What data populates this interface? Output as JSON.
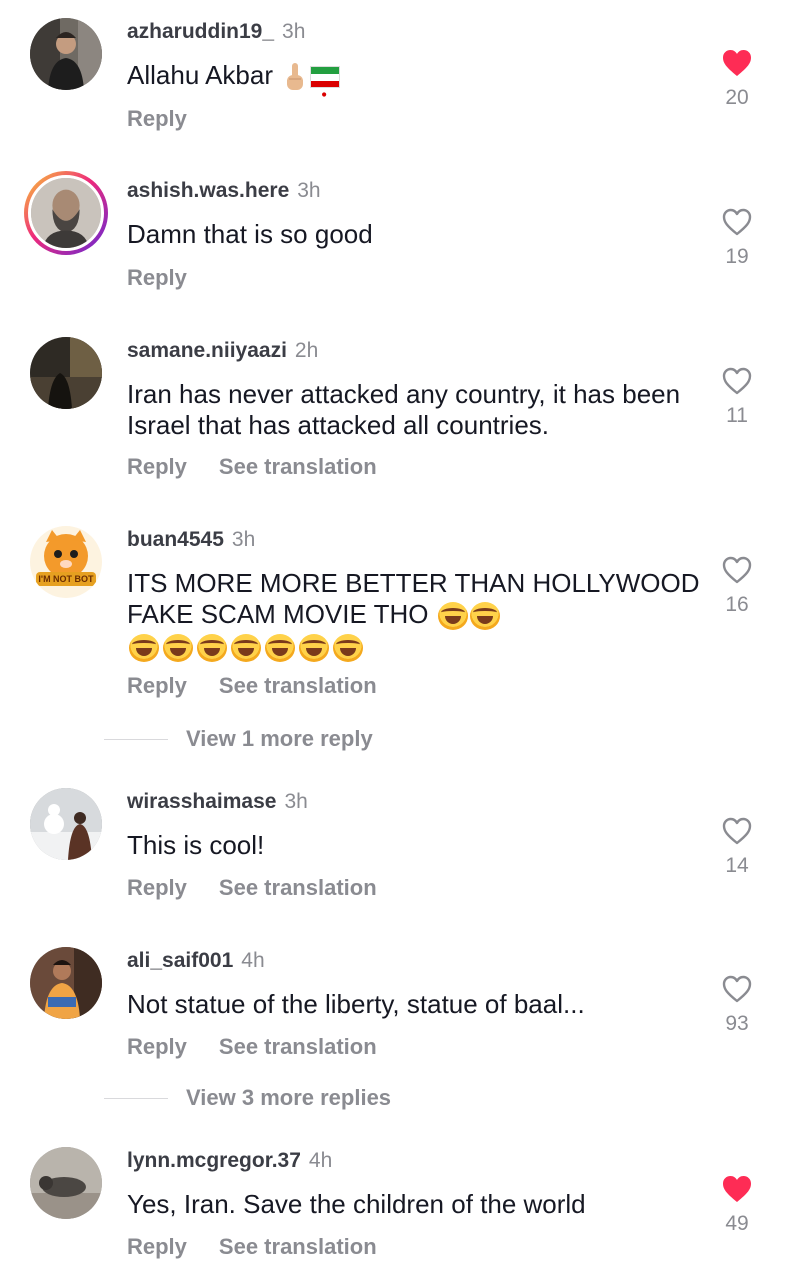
{
  "comments": [
    {
      "username": "azharuddin19_",
      "time": "3h",
      "text": "Allahu Akbar",
      "likes": "20",
      "liked": true,
      "reply": "Reply",
      "translate": null
    },
    {
      "username": "ashish.was.here",
      "time": "3h",
      "text": "Damn that is so good",
      "likes": "19",
      "liked": false,
      "reply": "Reply",
      "translate": null
    },
    {
      "username": "samane.niiyaazi",
      "time": "2h",
      "text": "Iran has never attacked any country, it has been Israel that has attacked all countries.",
      "likes": "11",
      "liked": false,
      "reply": "Reply",
      "translate": "See translation"
    },
    {
      "username": "buan4545",
      "time": "3h",
      "text": "ITS MORE MORE BETTER THAN HOLLYWOOD FAKE SCAM MOVIE THO",
      "likes": "16",
      "liked": false,
      "reply": "Reply",
      "translate": "See translation",
      "avatar_badge": "I'M NOT BOT"
    },
    {
      "username": "wirasshaimase",
      "time": "3h",
      "text": "This is cool!",
      "likes": "14",
      "liked": false,
      "reply": "Reply",
      "translate": "See translation"
    },
    {
      "username": "ali_saif001",
      "time": "4h",
      "text": "Not statue of the liberty,  statue of baal...",
      "likes": "93",
      "liked": false,
      "reply": "Reply",
      "translate": "See translation"
    },
    {
      "username": "lynn.mcgregor.37",
      "time": "4h",
      "text": "Yes, Iran. Save the children of the world",
      "likes": "49",
      "liked": true,
      "reply": "Reply",
      "translate": "See translation"
    }
  ],
  "more_replies": [
    "View 1 more reply",
    "View 3 more replies"
  ],
  "icons": {
    "like": "heart-icon",
    "liked_color": "#fe2c55",
    "unliked_color": "#8a8b91"
  }
}
